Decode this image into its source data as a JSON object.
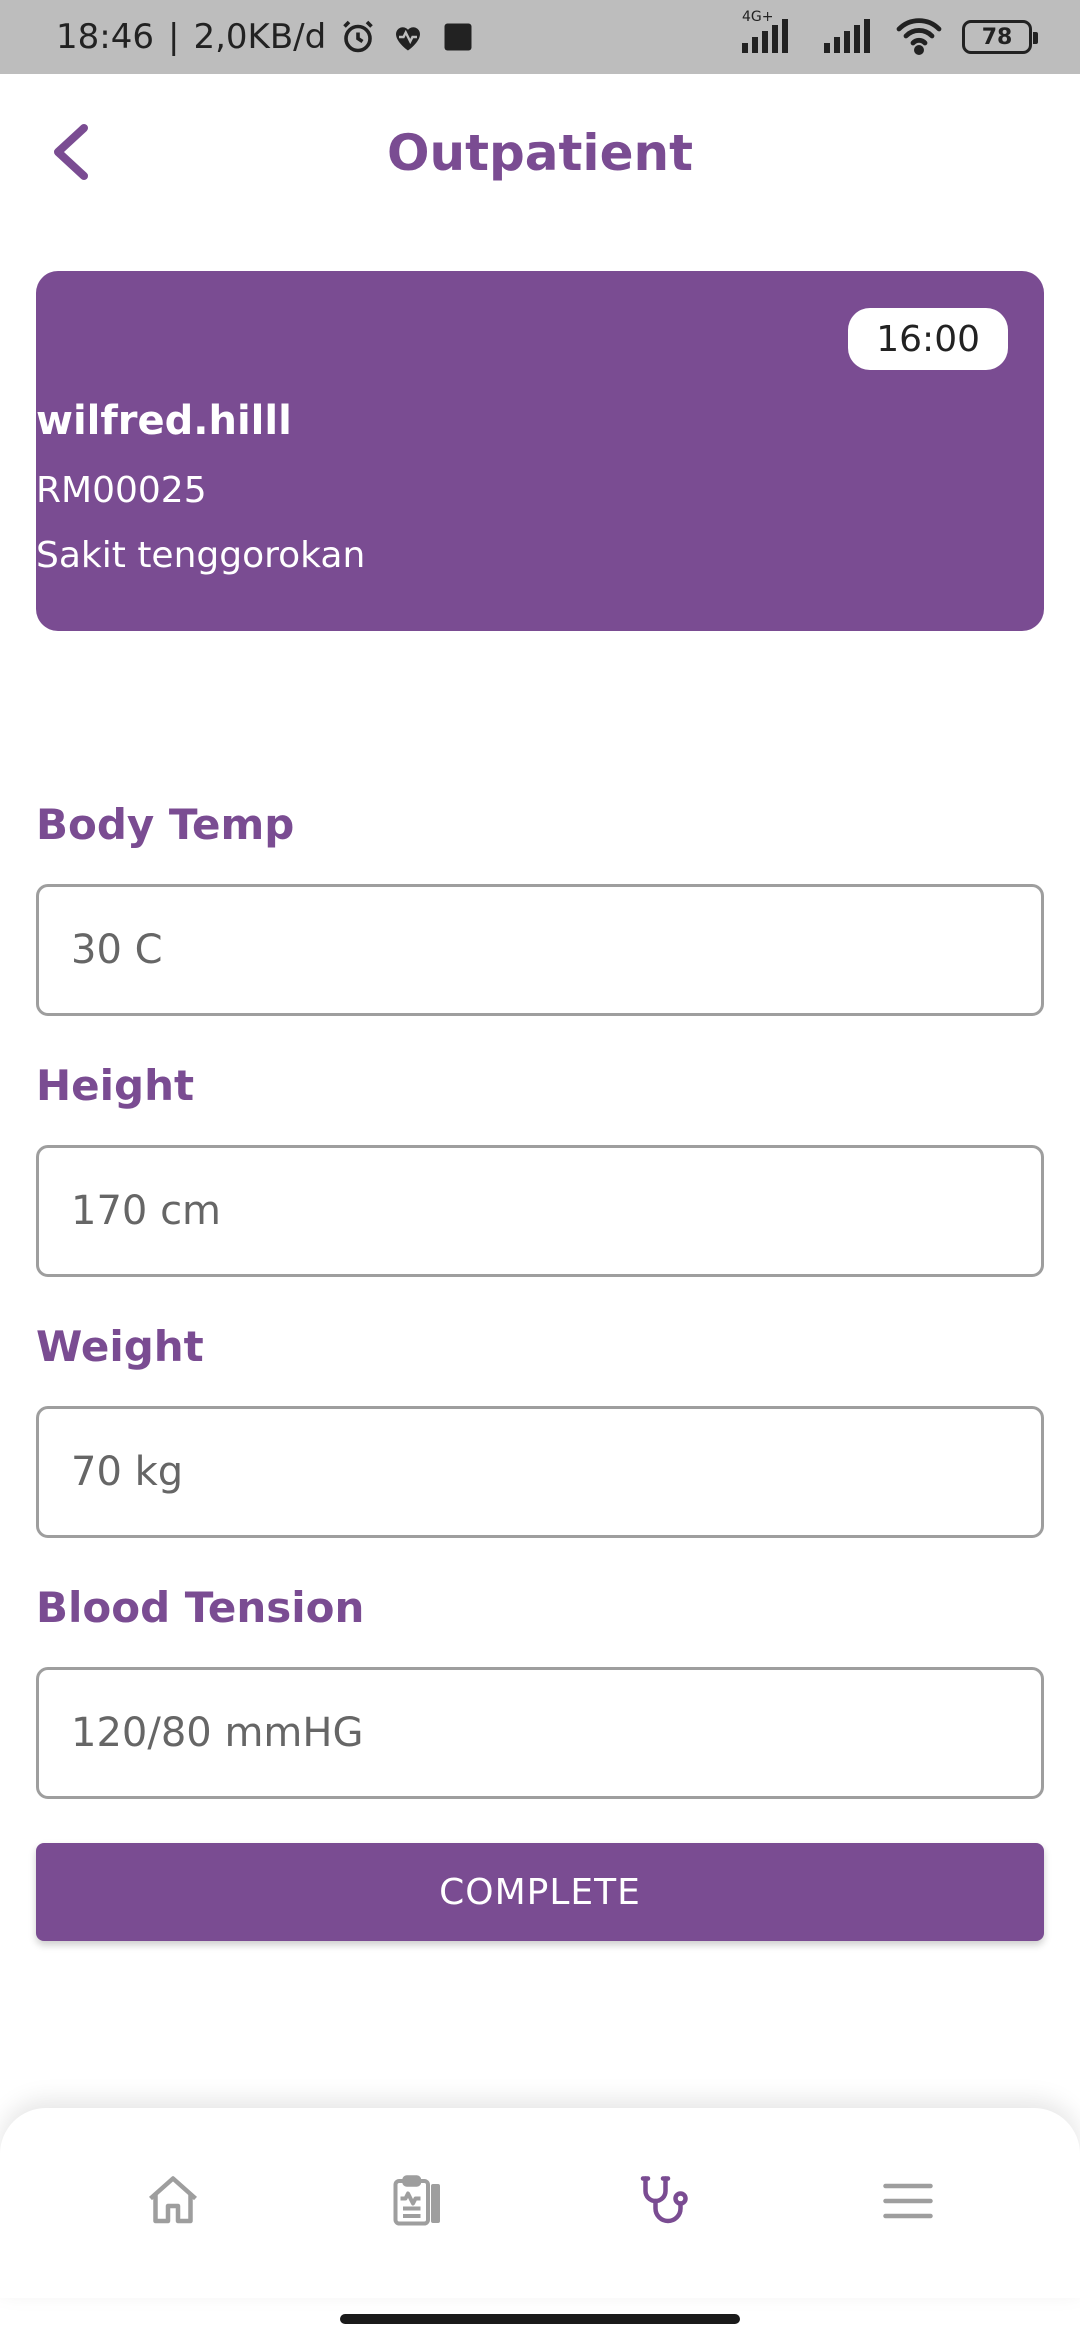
{
  "status_bar": {
    "time": "18:46",
    "separator": "|",
    "data_rate": "2,0KB/d",
    "network_type": "4G+",
    "battery": "78",
    "icons": [
      "alarm-icon",
      "heart-icon",
      "square-icon",
      "signal-icon",
      "signal-icon",
      "wifi-icon"
    ]
  },
  "header": {
    "title": "Outpatient",
    "back_icon": "chevron-left-icon"
  },
  "patient": {
    "time": "16:00",
    "name": "wilfred.hilll",
    "record_number": "RM00025",
    "complaint": "Sakit tenggorokan"
  },
  "form": {
    "body_temp": {
      "label": "Body Temp",
      "placeholder": "30 C"
    },
    "height": {
      "label": "Height",
      "placeholder": "170 cm"
    },
    "weight": {
      "label": "Weight",
      "placeholder": "70 kg"
    },
    "blood_tension": {
      "label": "Blood Tension",
      "placeholder": "120/80 mmHG"
    },
    "submit_label": "COMPLETE"
  },
  "bottom_nav": {
    "items": [
      {
        "icon": "home-icon",
        "active": false
      },
      {
        "icon": "clipboard-icon",
        "active": false
      },
      {
        "icon": "stethoscope-icon",
        "active": true
      },
      {
        "icon": "menu-icon",
        "active": false
      }
    ]
  },
  "colors": {
    "primary": "#7a4c92",
    "inactive_icon": "#9e9e9e",
    "status_bar": "#bdbdbd"
  }
}
